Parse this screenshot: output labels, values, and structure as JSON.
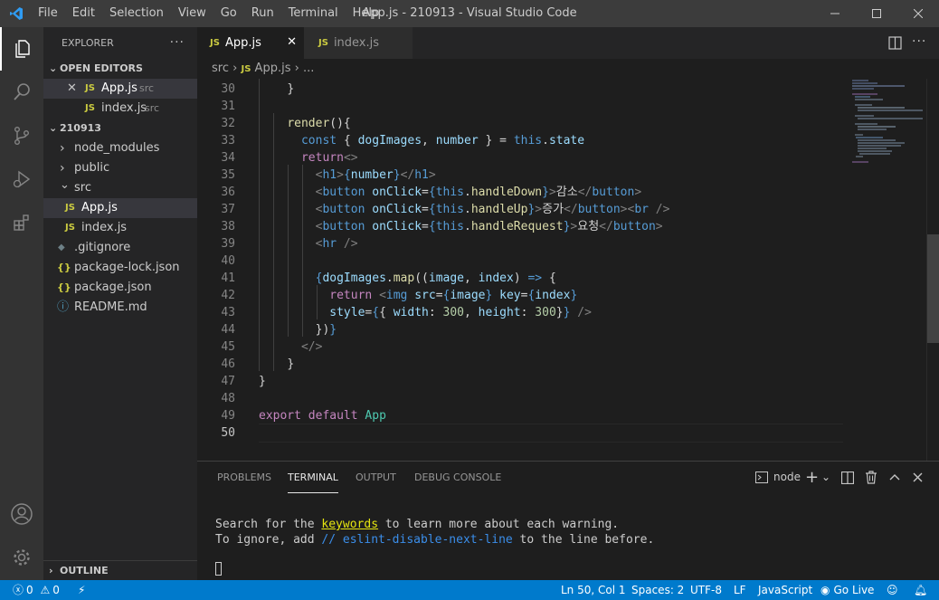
{
  "window": {
    "title": "App.js - 210913 - Visual Studio Code",
    "menu": [
      "File",
      "Edit",
      "Selection",
      "View",
      "Go",
      "Run",
      "Terminal",
      "Help"
    ]
  },
  "activity_bar": [
    "files-icon",
    "search-icon",
    "source-control-icon",
    "run-debug-icon",
    "extensions-icon",
    "account-icon",
    "settings-gear-icon"
  ],
  "sidebar": {
    "title": "EXPLORER",
    "more": "···",
    "open_editors_label": "OPEN EDITORS",
    "open_editors": [
      {
        "name": "App.js",
        "dir": "src",
        "icon": "JS"
      },
      {
        "name": "index.js",
        "dir": "src",
        "icon": "JS"
      }
    ],
    "project_label": "210913",
    "tree": [
      {
        "name": "node_modules",
        "icon": "›"
      },
      {
        "name": "public",
        "icon": "›"
      },
      {
        "name": "src",
        "icon": "⌄"
      },
      {
        "name": "App.js",
        "icon": "JS"
      },
      {
        "name": "index.js",
        "icon": "JS"
      },
      {
        "name": ".gitignore",
        "icon": "◆"
      },
      {
        "name": "package-lock.json",
        "icon": "{}"
      },
      {
        "name": "package.json",
        "icon": "{}"
      },
      {
        "name": "README.md",
        "icon": "ⓘ"
      }
    ],
    "outline_label": "OUTLINE"
  },
  "tabs": [
    {
      "label": "App.js",
      "icon": "JS",
      "active": true
    },
    {
      "label": "index.js",
      "icon": "JS",
      "active": false
    }
  ],
  "breadcrumb": {
    "folder": "src",
    "file": "App.js",
    "more": "..."
  },
  "editor": {
    "line_numbers": [
      "30",
      "31",
      "32",
      "33",
      "34",
      "35",
      "36",
      "37",
      "38",
      "39",
      "40",
      "41",
      "42",
      "43",
      "44",
      "45",
      "46",
      "47",
      "48",
      "49",
      "50"
    ],
    "current_line": "50"
  },
  "panel": {
    "tabs": [
      "PROBLEMS",
      "TERMINAL",
      "OUTPUT",
      "DEBUG CONSOLE"
    ],
    "active_tab": "TERMINAL",
    "terminal_name": "node",
    "line1_a": "Search for the ",
    "line1_kw": "keywords",
    "line1_b": " to learn more about each warning.",
    "line2_a": "To ignore, add ",
    "line2_kw": "// eslint-disable-next-line",
    "line2_b": " to the line before."
  },
  "status": {
    "errors": "0",
    "warnings": "0",
    "position": "Ln 50, Col 1",
    "spaces": "Spaces: 2",
    "encoding": "UTF-8",
    "eol": "LF",
    "language": "JavaScript",
    "golive": "Go Live"
  },
  "colors": {
    "accent": "#007acc",
    "js_icon": "#cbcb41"
  }
}
